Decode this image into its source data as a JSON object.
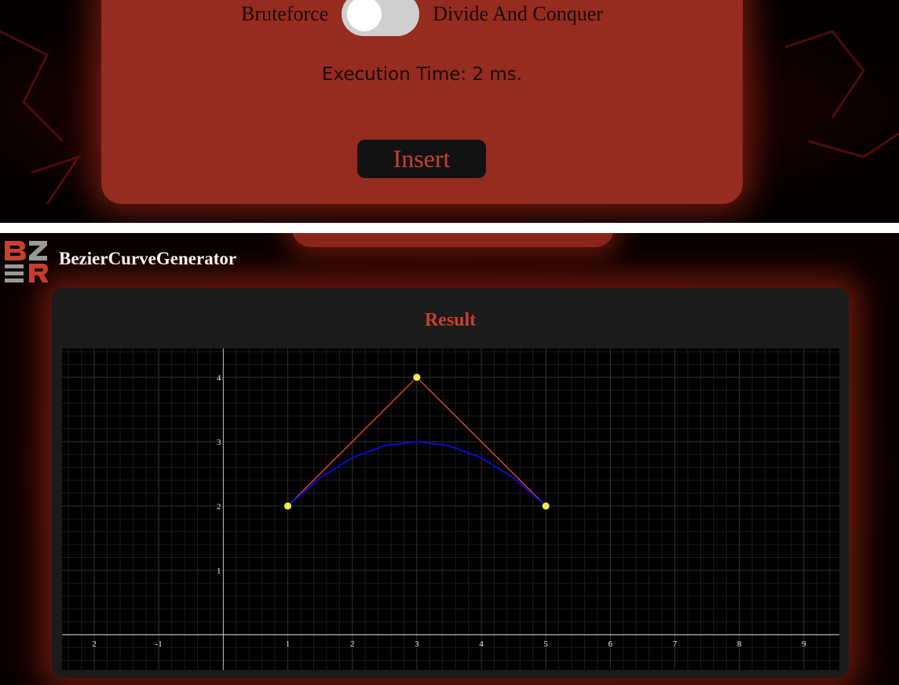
{
  "controls": {
    "left_label": "Bruteforce",
    "right_label": "Divide And Conquer",
    "toggle_on": false,
    "execution_time": "Execution Time: 2 ms.",
    "insert_label": "Insert"
  },
  "app": {
    "title": "BezierCurveGenerator",
    "logo_letters": "BZR"
  },
  "result": {
    "heading": "Result"
  },
  "colors": {
    "accent": "#c8402e",
    "card": "#962b20",
    "control_line": "#d8452c",
    "curve": "#0a0ad0",
    "control_point": "#f5e94a",
    "axis": "#ffffff",
    "grid": "#2e2e2e"
  },
  "chart_data": {
    "type": "line",
    "title": "",
    "xlabel": "",
    "ylabel": "",
    "xlim": [
      -2.5,
      9.55
    ],
    "ylim": [
      -0.55,
      4.45
    ],
    "x_ticks": [
      -2,
      -1,
      1,
      2,
      3,
      4,
      5,
      6,
      7,
      8,
      9
    ],
    "x_tick_labels": [
      "2",
      "-1",
      "1",
      "2",
      "3",
      "4",
      "5",
      "6",
      "7",
      "8",
      "9"
    ],
    "y_ticks": [
      1,
      2,
      3,
      4
    ],
    "y_tick_labels": [
      "1",
      "2",
      "3",
      "4"
    ],
    "grid": true,
    "series": [
      {
        "role": "control-polygon",
        "x": [
          1,
          3,
          5
        ],
        "y": [
          2,
          4,
          2
        ]
      },
      {
        "role": "bezier-curve",
        "x": [
          1,
          1.5,
          2,
          2.5,
          3,
          3.5,
          4,
          4.5,
          5
        ],
        "y": [
          2,
          2.4375,
          2.75,
          2.9375,
          3,
          2.9375,
          2.75,
          2.4375,
          2
        ]
      }
    ],
    "control_points": [
      {
        "x": 1,
        "y": 2
      },
      {
        "x": 3,
        "y": 4
      },
      {
        "x": 5,
        "y": 2
      }
    ]
  }
}
